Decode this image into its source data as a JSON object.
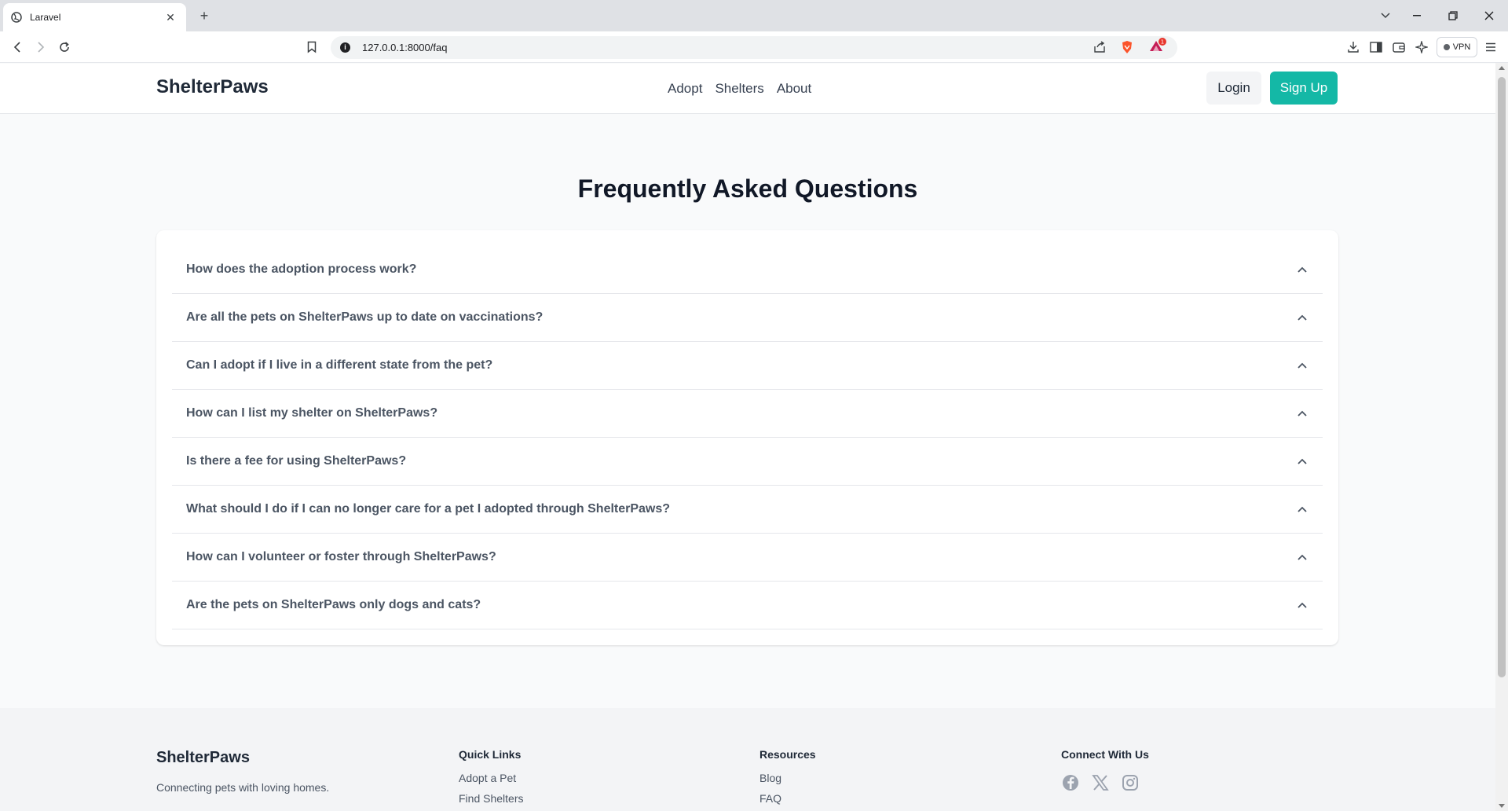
{
  "browser": {
    "tab_title": "Laravel",
    "url": "127.0.0.1:8000/faq",
    "vpn_label": "VPN",
    "notification_count": "1"
  },
  "header": {
    "brand": "ShelterPaws",
    "nav": [
      "Adopt",
      "Shelters",
      "About"
    ],
    "login_label": "Login",
    "signup_label": "Sign Up"
  },
  "faq": {
    "title": "Frequently Asked Questions",
    "questions": [
      "How does the adoption process work?",
      "Are all the pets on ShelterPaws up to date on vaccinations?",
      "Can I adopt if I live in a different state from the pet?",
      "How can I list my shelter on ShelterPaws?",
      "Is there a fee for using ShelterPaws?",
      "What should I do if I can no longer care for a pet I adopted through ShelterPaws?",
      "How can I volunteer or foster through ShelterPaws?",
      "Are the pets on ShelterPaws only dogs and cats?"
    ]
  },
  "footer": {
    "brand": "ShelterPaws",
    "tagline": "Connecting pets with loving homes.",
    "quick_links": {
      "heading": "Quick Links",
      "links": [
        "Adopt a Pet",
        "Find Shelters"
      ]
    },
    "resources": {
      "heading": "Resources",
      "links": [
        "Blog",
        "FAQ"
      ]
    },
    "connect": {
      "heading": "Connect With Us",
      "icons": [
        "facebook-icon",
        "x-icon",
        "instagram-icon"
      ]
    }
  },
  "colors": {
    "accent": "#14b8a6",
    "page_bg": "#f9fafb",
    "footer_bg": "#f3f4f6"
  }
}
